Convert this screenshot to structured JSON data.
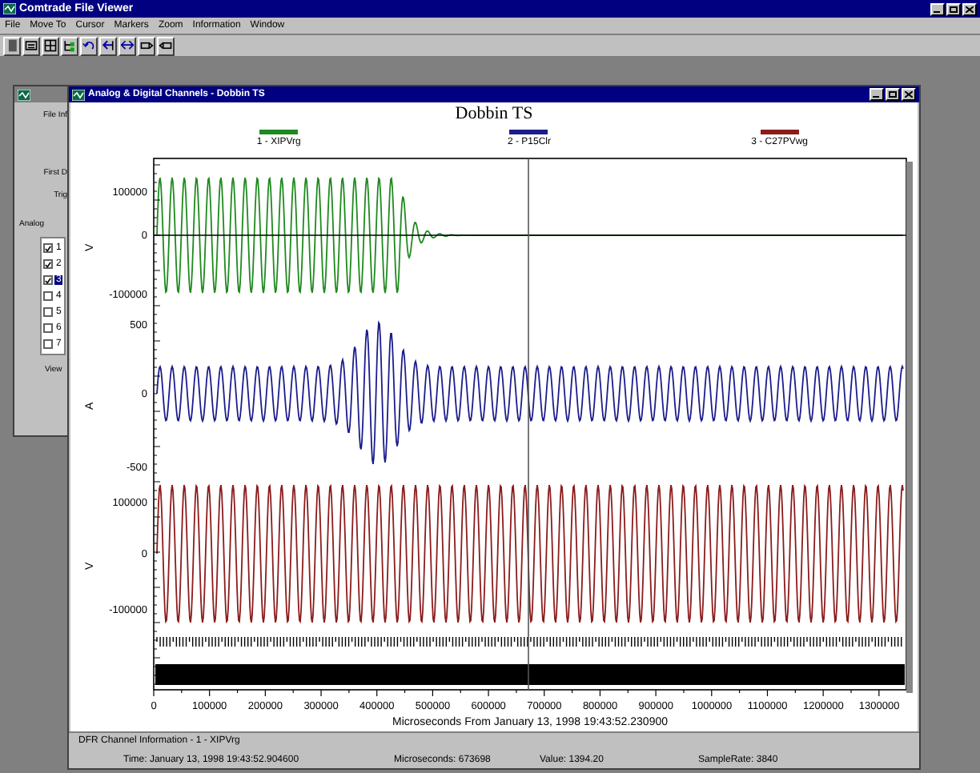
{
  "app": {
    "title": "Comtrade File Viewer"
  },
  "menu": [
    "File",
    "Move To",
    "Cursor",
    "Markers",
    "Zoom",
    "Information",
    "Window"
  ],
  "back_panel": {
    "labels": [
      "File Inf",
      "First D",
      "Trig"
    ],
    "group": "Analog",
    "view_label": "View",
    "channels": [
      {
        "label": "1",
        "checked": true,
        "selected": false
      },
      {
        "label": "2",
        "checked": true,
        "selected": false
      },
      {
        "label": "3",
        "checked": true,
        "selected": true
      },
      {
        "label": "4",
        "checked": false,
        "selected": false
      },
      {
        "label": "5",
        "checked": false,
        "selected": false
      },
      {
        "label": "6",
        "checked": false,
        "selected": false
      },
      {
        "label": "7",
        "checked": false,
        "selected": false
      }
    ]
  },
  "window": {
    "title": "Analog & Digital Channels - Dobbin TS"
  },
  "chart": {
    "title": "Dobbin TS",
    "traces": [
      {
        "label": "1 - XIPVrg",
        "color": "#1f8a1f",
        "unit": "V",
        "yticks": [
          "100000",
          "0",
          "-100000"
        ]
      },
      {
        "label": "2 - P15Clr",
        "color": "#1c1c8c",
        "unit": "A",
        "yticks": [
          "500",
          "0",
          "-500"
        ]
      },
      {
        "label": "3 - C27PVwg",
        "color": "#8c1c1c",
        "unit": "V",
        "yticks": [
          "100000",
          "0",
          "-100000"
        ]
      }
    ],
    "xticks": [
      "0",
      "100000",
      "200000",
      "300000",
      "400000",
      "500000",
      "600000",
      "700000",
      "800000",
      "900000",
      "1000000",
      "1100000",
      "1200000",
      "1300000"
    ],
    "xlabel": "Microseconds From January 13, 1998 19:43:52.230900"
  },
  "status": {
    "title": "DFR Channel Information - 1 - XIPVrg",
    "fields": [
      {
        "label": "Time:",
        "value": "January 13, 1998 19:43:52.904600"
      },
      {
        "label": "Microseconds:",
        "value": "673698"
      },
      {
        "label": "Value:",
        "value": "1394.20"
      },
      {
        "label": "SampleRate:",
        "value": "3840"
      }
    ]
  }
}
